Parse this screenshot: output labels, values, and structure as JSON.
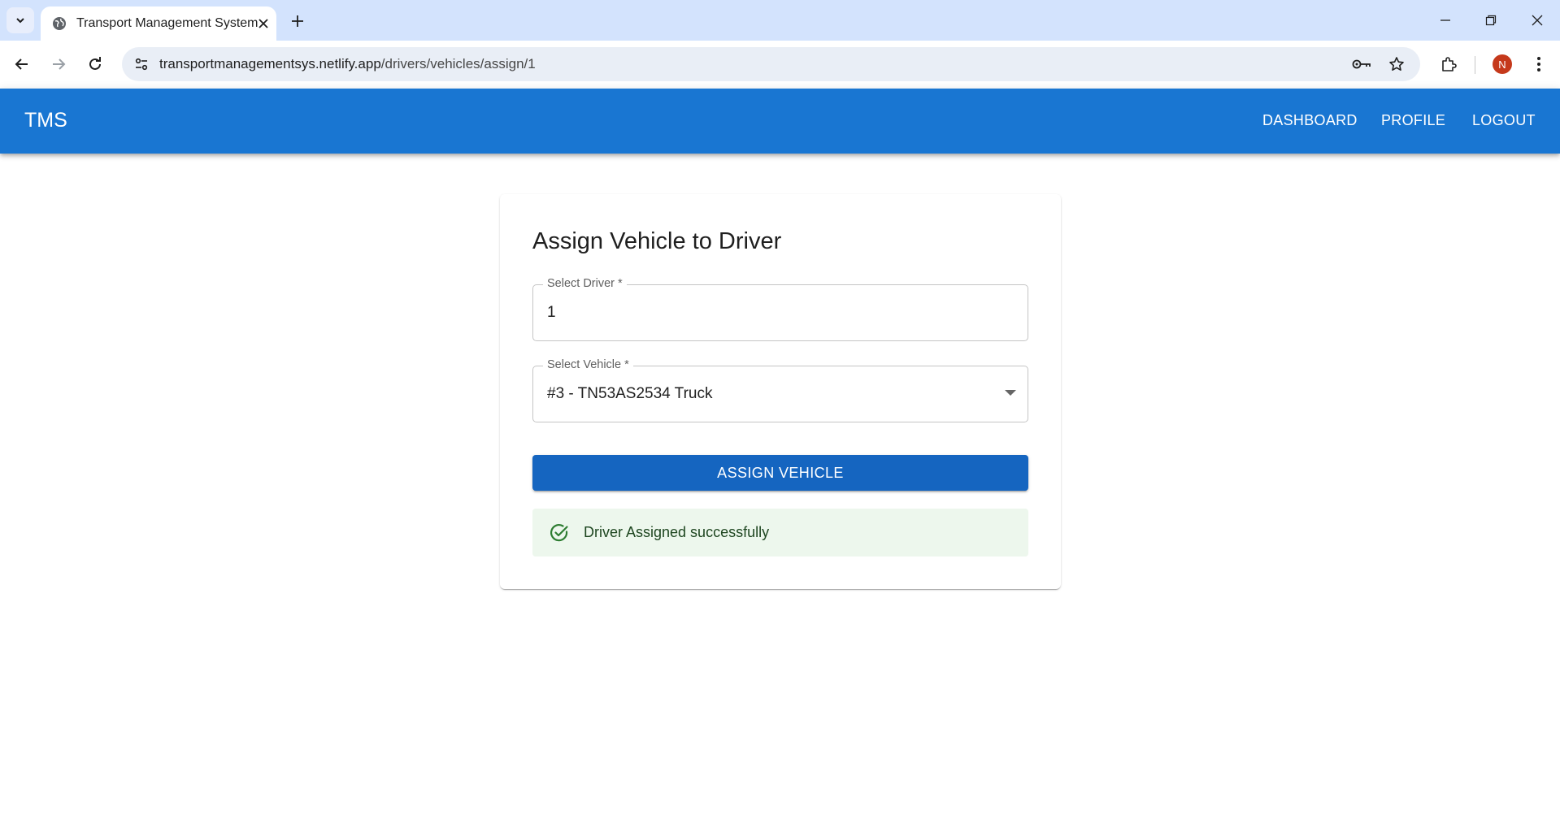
{
  "browser": {
    "tab_title": "Transport Management System",
    "url_host": "transportmanagementsys.netlify.app",
    "url_path": "/drivers/vehicles/assign/1",
    "profile_initial": "N"
  },
  "appbar": {
    "brand": "TMS",
    "nav": [
      "DASHBOARD",
      "PROFILE",
      "LOGOUT"
    ],
    "color": "#1976d2"
  },
  "form": {
    "title": "Assign Vehicle to Driver",
    "driver": {
      "label": "Select Driver *",
      "value": "1"
    },
    "vehicle": {
      "label": "Select Vehicle *",
      "value": "#3 - TN53AS2534 Truck"
    },
    "submit_label": "ASSIGN VEHICLE",
    "alert": {
      "message": "Driver Assigned successfully",
      "severity": "success",
      "icon": "check-circle-icon"
    }
  }
}
